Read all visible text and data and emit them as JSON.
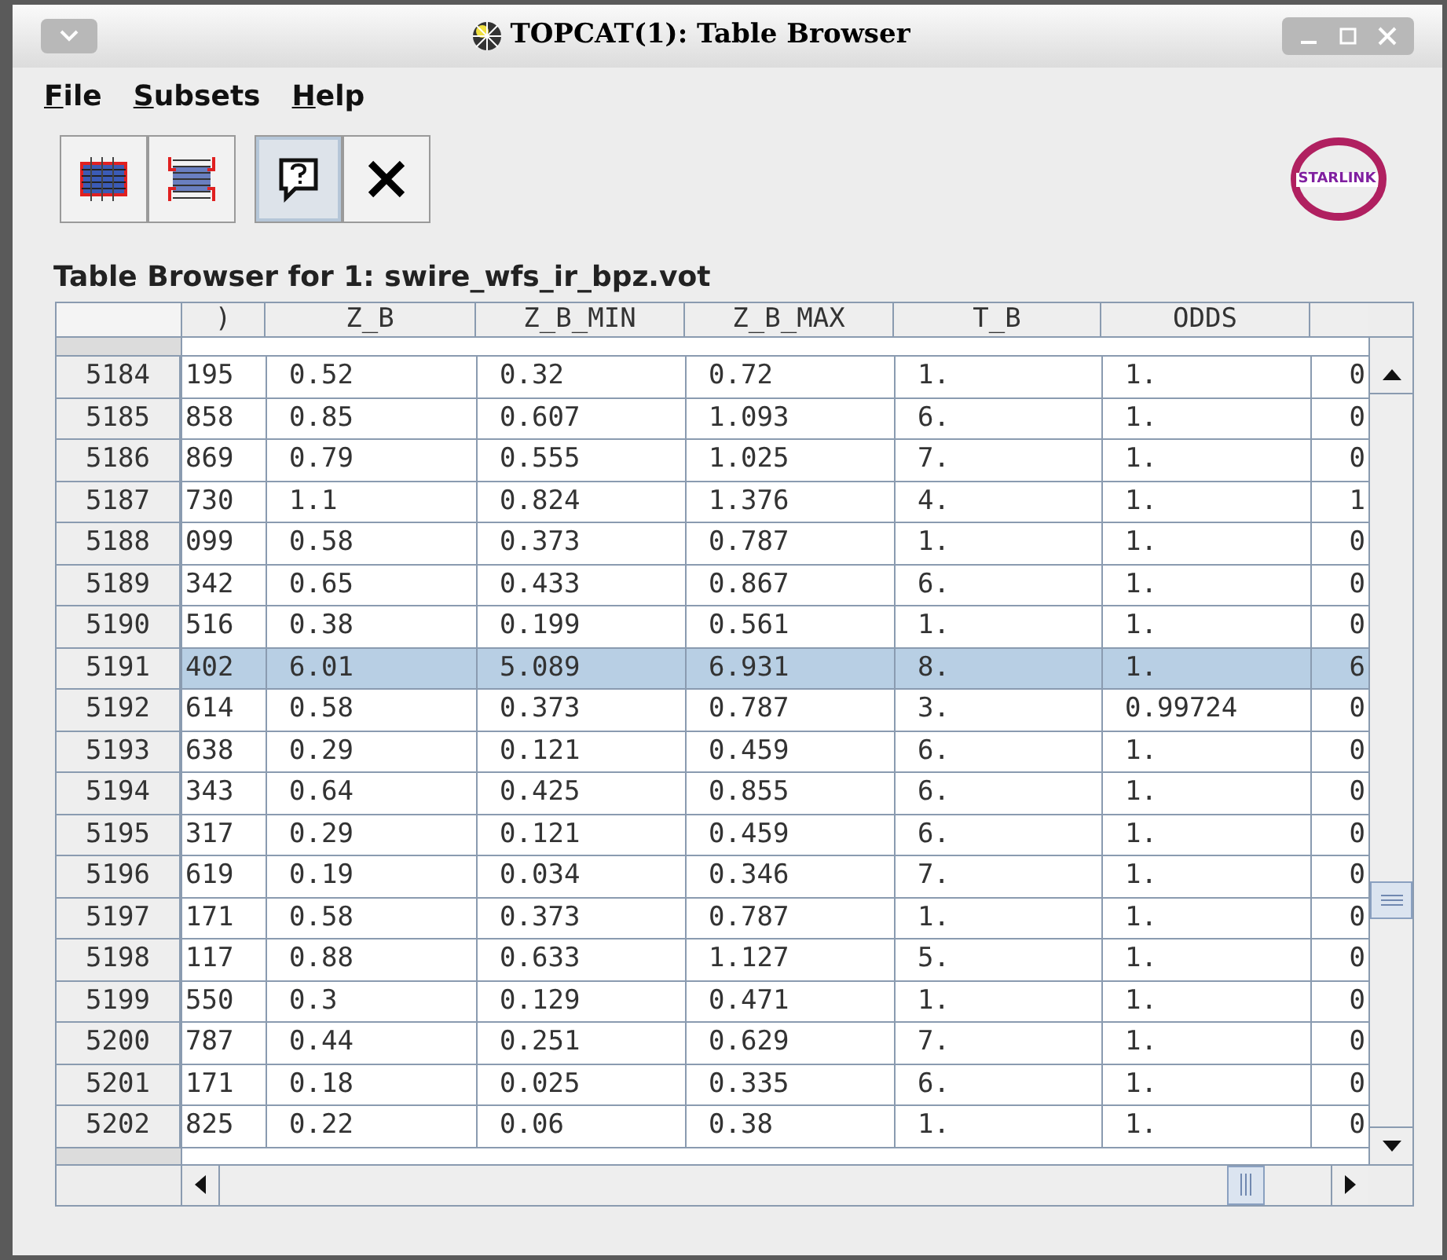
{
  "window": {
    "title": "TOPCAT(1): Table Browser"
  },
  "menu": [
    "File",
    "Subsets",
    "Help"
  ],
  "toolbar": [
    {
      "kind": "columns"
    },
    {
      "kind": "rows"
    },
    {
      "kind": "help",
      "selected": true
    },
    {
      "kind": "close"
    }
  ],
  "logo_text": "STARLINK",
  "table_title": "Table Browser for 1: swire_wfs_ir_bpz.vot",
  "table": {
    "columns": [
      ")",
      "Z_B",
      "Z_B_MIN",
      "Z_B_MAX",
      "T_B",
      "ODDS"
    ],
    "rows": [
      {
        "index": "5184",
        "cells": [
          "195",
          "0.52",
          "0.32",
          "0.72",
          "1.",
          "1.",
          "0"
        ],
        "selected": false
      },
      {
        "index": "5185",
        "cells": [
          "858",
          "0.85",
          "0.607",
          "1.093",
          "6.",
          "1.",
          "0"
        ],
        "selected": false
      },
      {
        "index": "5186",
        "cells": [
          "869",
          "0.79",
          "0.555",
          "1.025",
          "7.",
          "1.",
          "0"
        ],
        "selected": false
      },
      {
        "index": "5187",
        "cells": [
          "730",
          "1.1",
          "0.824",
          "1.376",
          "4.",
          "1.",
          "1"
        ],
        "selected": false
      },
      {
        "index": "5188",
        "cells": [
          "099",
          "0.58",
          "0.373",
          "0.787",
          "1.",
          "1.",
          "0"
        ],
        "selected": false
      },
      {
        "index": "5189",
        "cells": [
          "342",
          "0.65",
          "0.433",
          "0.867",
          "6.",
          "1.",
          "0"
        ],
        "selected": false
      },
      {
        "index": "5190",
        "cells": [
          "516",
          "0.38",
          "0.199",
          "0.561",
          "1.",
          "1.",
          "0"
        ],
        "selected": false
      },
      {
        "index": "5191",
        "cells": [
          "402",
          "6.01",
          "5.089",
          "6.931",
          "8.",
          "1.",
          "6"
        ],
        "selected": true
      },
      {
        "index": "5192",
        "cells": [
          "614",
          "0.58",
          "0.373",
          "0.787",
          "3.",
          "0.99724",
          "0"
        ],
        "selected": false
      },
      {
        "index": "5193",
        "cells": [
          "638",
          "0.29",
          "0.121",
          "0.459",
          "6.",
          "1.",
          "0"
        ],
        "selected": false
      },
      {
        "index": "5194",
        "cells": [
          "343",
          "0.64",
          "0.425",
          "0.855",
          "6.",
          "1.",
          "0"
        ],
        "selected": false
      },
      {
        "index": "5195",
        "cells": [
          "317",
          "0.29",
          "0.121",
          "0.459",
          "6.",
          "1.",
          "0"
        ],
        "selected": false
      },
      {
        "index": "5196",
        "cells": [
          "619",
          "0.19",
          "0.034",
          "0.346",
          "7.",
          "1.",
          "0"
        ],
        "selected": false
      },
      {
        "index": "5197",
        "cells": [
          "171",
          "0.58",
          "0.373",
          "0.787",
          "1.",
          "1.",
          "0"
        ],
        "selected": false
      },
      {
        "index": "5198",
        "cells": [
          "117",
          "0.88",
          "0.633",
          "1.127",
          "5.",
          "1.",
          "0"
        ],
        "selected": false
      },
      {
        "index": "5199",
        "cells": [
          "550",
          "0.3",
          "0.129",
          "0.471",
          "1.",
          "1.",
          "0"
        ],
        "selected": false
      },
      {
        "index": "5200",
        "cells": [
          "787",
          "0.44",
          "0.251",
          "0.629",
          "7.",
          "1.",
          "0"
        ],
        "selected": false
      },
      {
        "index": "5201",
        "cells": [
          "171",
          "0.18",
          "0.025",
          "0.335",
          "6.",
          "1.",
          "0"
        ],
        "selected": false
      },
      {
        "index": "5202",
        "cells": [
          "825",
          "0.22",
          "0.06",
          "0.38",
          "1.",
          "1.",
          "0"
        ],
        "selected": false
      }
    ]
  }
}
